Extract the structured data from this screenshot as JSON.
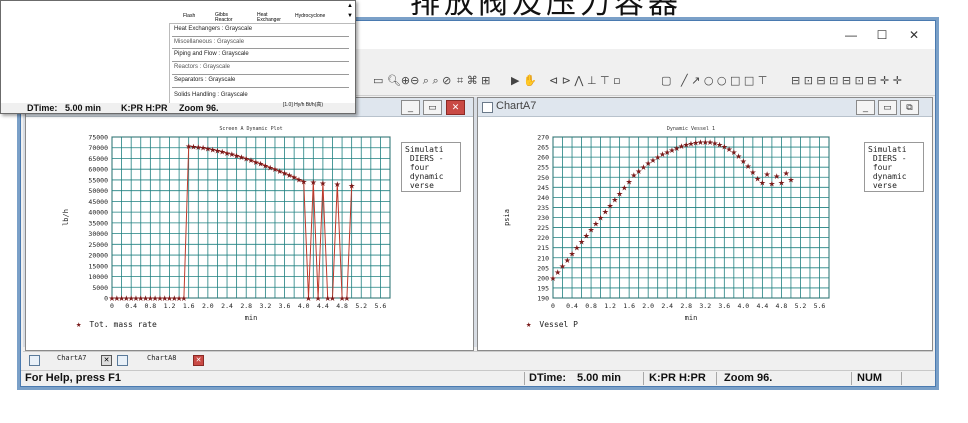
{
  "banner_text": "排放阀及压力容器",
  "window_controls": {
    "minimize": "—",
    "maximize": "☐",
    "close": "✕"
  },
  "palette": {
    "icon_labels": [
      "Flash",
      "Gibbs Reactor",
      "Heat Exchanger",
      "Hydrocyclone"
    ],
    "categories": [
      "Heat Exchangers : Grayscale",
      "Miscellaneous : Grayscale",
      "Piping and Flow : Grayscale",
      "Reactors : Grayscale",
      "Separators : Grayscale",
      "Solids Handling : Grayscale"
    ],
    "status": {
      "dtime": "DTime:",
      "dtime_val": "5.00 min",
      "kpr": "K:PR H:PR",
      "zoom": "Zoom 96.",
      "extra": "[1.0] Hy/h Bt/h(高)"
    }
  },
  "chart_left": {
    "window_title": "",
    "legend_text": "Simulati\n DIERS -\n four\n dynamic\n verse",
    "legend_bottom": "Tot. mass rate"
  },
  "chart_right": {
    "window_title": "ChartA7",
    "legend_text": "Simulati\n DIERS -\n four\n dynamic\n verse",
    "legend_bottom": "Vessel P"
  },
  "tabs": [
    {
      "label": "ChartA7"
    },
    {
      "label": "ChartA8"
    }
  ],
  "status": {
    "help": "For Help, press F1",
    "dtime_label": "DTime:",
    "dtime_value": "5.00 min",
    "kpr": "K:PR H:PR",
    "zoom": "Zoom 96.",
    "num": "NUM"
  },
  "chart_data": [
    {
      "type": "line",
      "title": "Screen A Dynamic Plot",
      "xlabel": "min",
      "ylabel": "lb/h",
      "xlim": [
        0,
        5.8
      ],
      "ylim": [
        0,
        75000
      ],
      "x_ticks": [
        "0",
        "0.4",
        "0.8",
        "1.2",
        "1.6",
        "2.0",
        "2.4",
        "2.8",
        "3.2",
        "3.6",
        "4.0",
        "4.4",
        "4.8",
        "5.2",
        "5.6"
      ],
      "y_ticks": [
        "0",
        "5000",
        "10000",
        "15000",
        "20000",
        "25000",
        "30000",
        "35000",
        "40000",
        "45000",
        "50000",
        "55000",
        "60000",
        "65000",
        "70000",
        "75000"
      ],
      "grid": true,
      "series": [
        {
          "name": "Tot. mass rate",
          "marker": "star",
          "color": "#7a1a1a",
          "x": [
            0,
            0.1,
            0.2,
            0.3,
            0.4,
            0.5,
            0.6,
            0.7,
            0.8,
            0.9,
            1.0,
            1.1,
            1.2,
            1.3,
            1.4,
            1.5,
            1.6,
            1.7,
            1.8,
            1.9,
            2.0,
            2.1,
            2.2,
            2.3,
            2.4,
            2.5,
            2.6,
            2.7,
            2.8,
            2.9,
            3.0,
            3.1,
            3.2,
            3.3,
            3.4,
            3.5,
            3.6,
            3.7,
            3.8,
            3.9,
            4.0,
            4.1,
            4.2,
            4.3,
            4.4,
            4.5,
            4.6,
            4.7,
            4.8,
            4.9,
            5.0
          ],
          "y": [
            0,
            0,
            0,
            0,
            0,
            0,
            0,
            0,
            0,
            0,
            0,
            0,
            0,
            0,
            0,
            0,
            70800,
            70500,
            70300,
            70000,
            69600,
            69200,
            68700,
            68200,
            67600,
            67000,
            66400,
            65700,
            65000,
            64200,
            63400,
            62600,
            61700,
            60900,
            60000,
            59100,
            58200,
            57300,
            56300,
            55300,
            54300,
            0,
            54000,
            0,
            53500,
            0,
            0,
            53000,
            0,
            0,
            52500
          ]
        }
      ]
    },
    {
      "type": "scatter",
      "title": "Dynamic Vessel 1",
      "xlabel": "min",
      "ylabel": "psia",
      "xlim": [
        0,
        5.8
      ],
      "ylim": [
        190,
        270
      ],
      "x_ticks": [
        "0",
        "0.4",
        "0.8",
        "1.2",
        "1.6",
        "2.0",
        "2.4",
        "2.8",
        "3.2",
        "3.6",
        "4.0",
        "4.4",
        "4.8",
        "5.2",
        "5.6"
      ],
      "y_ticks": [
        "190",
        "195",
        "200",
        "205",
        "210",
        "215",
        "220",
        "225",
        "230",
        "235",
        "240",
        "245",
        "250",
        "255",
        "260",
        "265",
        "270"
      ],
      "grid": true,
      "series": [
        {
          "name": "Vessel P",
          "marker": "star",
          "color": "#7a1a1a",
          "x": [
            0,
            0.1,
            0.2,
            0.3,
            0.4,
            0.5,
            0.6,
            0.7,
            0.8,
            0.9,
            1.0,
            1.1,
            1.2,
            1.3,
            1.4,
            1.5,
            1.6,
            1.7,
            1.8,
            1.9,
            2.0,
            2.1,
            2.2,
            2.3,
            2.4,
            2.5,
            2.6,
            2.7,
            2.8,
            2.9,
            3.0,
            3.1,
            3.2,
            3.3,
            3.4,
            3.5,
            3.6,
            3.7,
            3.8,
            3.9,
            4.0,
            4.1,
            4.2,
            4.3,
            4.4,
            4.5,
            4.6,
            4.7,
            4.8,
            4.9,
            5.0
          ],
          "y": [
            200,
            203,
            206,
            209,
            212,
            215,
            218,
            221,
            224,
            227,
            230,
            233,
            236,
            239,
            242,
            245,
            248,
            251,
            253,
            255,
            257,
            258.5,
            260,
            261.5,
            262.5,
            263.5,
            264.5,
            265.5,
            266.3,
            266.8,
            267.2,
            267.5,
            267.6,
            267.4,
            267,
            266.3,
            265.3,
            264,
            262.5,
            260.5,
            258,
            255.5,
            252.5,
            249.5,
            247.5,
            251.5,
            247,
            250.5,
            247.5,
            252,
            249
          ]
        }
      ]
    }
  ]
}
